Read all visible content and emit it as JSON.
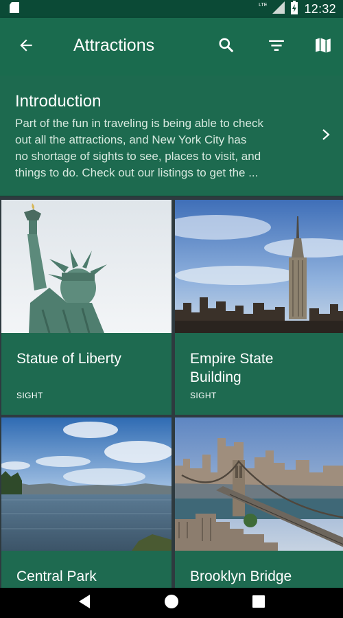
{
  "status_bar": {
    "time": "12:32",
    "network": "LTE",
    "icons": [
      "sd-card-icon",
      "signal-icon",
      "battery-charging-icon"
    ]
  },
  "app_bar": {
    "title": "Attractions",
    "icons": [
      "back-arrow-icon",
      "search-icon",
      "filter-icon",
      "map-icon"
    ]
  },
  "intro": {
    "title": "Introduction",
    "text_lines": [
      "Part of the fun in traveling is being able to check",
      "out all the attractions, and New York City has",
      "no shortage of sights to see, places to visit, and",
      "things to do. Check out our listings to get the ..."
    ]
  },
  "cards": [
    {
      "title": "Statue of Liberty",
      "type": "SIGHT",
      "image": "statue-of-liberty-photo"
    },
    {
      "title_lines": [
        "Empire State",
        "Building"
      ],
      "type": "SIGHT",
      "image": "empire-state-building-photo"
    },
    {
      "title": "Central Park",
      "image": "central-park-photo"
    },
    {
      "title": "Brooklyn Bridge",
      "image": "brooklyn-bridge-photo"
    }
  ],
  "nav": {
    "icons": [
      "back-triangle-icon",
      "home-circle-icon",
      "recents-square-icon"
    ]
  },
  "colors": {
    "app_bar": "#1a6b4e",
    "status_bar": "#0b4a36",
    "card": "#1e6a50",
    "background": "#2e3a3f"
  }
}
